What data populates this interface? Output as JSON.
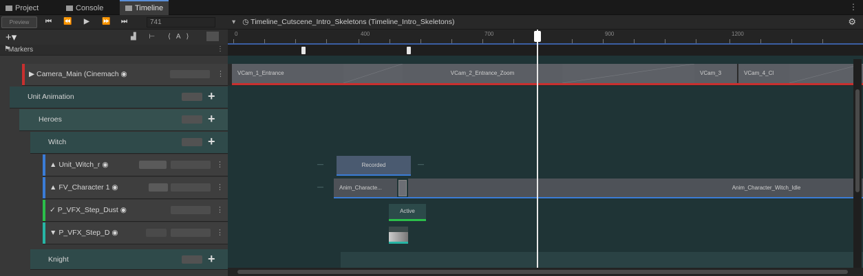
{
  "tabs": [
    {
      "label": "Project",
      "icon": "folder-icon"
    },
    {
      "label": "Console",
      "icon": "console-icon"
    },
    {
      "label": "Timeline",
      "icon": "timeline-icon"
    }
  ],
  "toolbar": {
    "preview_label": "Preview",
    "frame": "741",
    "sequence_title": "Timeline_Cutscene_Intro_Skeletons (Timeline_Intro_Skeletons)"
  },
  "left": {
    "add_label": "+",
    "markers_label": "Markers"
  },
  "tracks": [
    {
      "label": "Camera_Main (Cinemach",
      "color": "#c8302f"
    },
    {
      "label": "Unit Animation"
    },
    {
      "label": "Heroes"
    },
    {
      "label": "Witch"
    },
    {
      "label": "Unit_Witch_r",
      "color": "#3a7cd6"
    },
    {
      "label": "FV_Character 1",
      "color": "#3a7cd6"
    },
    {
      "label": "P_VFX_Step_Dust",
      "color": "#2bbf4a"
    },
    {
      "label": "P_VFX_Step_D",
      "color": "#27b5a5"
    },
    {
      "label": "Knight"
    }
  ],
  "ruler": {
    "ticks": [
      "0",
      "400",
      "700",
      "900",
      "1200"
    ]
  },
  "clips": {
    "camera": [
      "VCam_1_Entrance",
      "VCam_2_Entrance_Zoom",
      "VCam_3",
      "VCam_4_Cl"
    ],
    "recorded": "Recorded",
    "anim_short": "Anim_Characte...",
    "anim_long": "Anim_Character_Witch_Idle",
    "active": "Active"
  },
  "colors": {
    "accent": "#3b5fa4",
    "camera_track": "#c8302f",
    "anim_track": "#3a7cd6",
    "activation_track": "#2bbf4a"
  }
}
